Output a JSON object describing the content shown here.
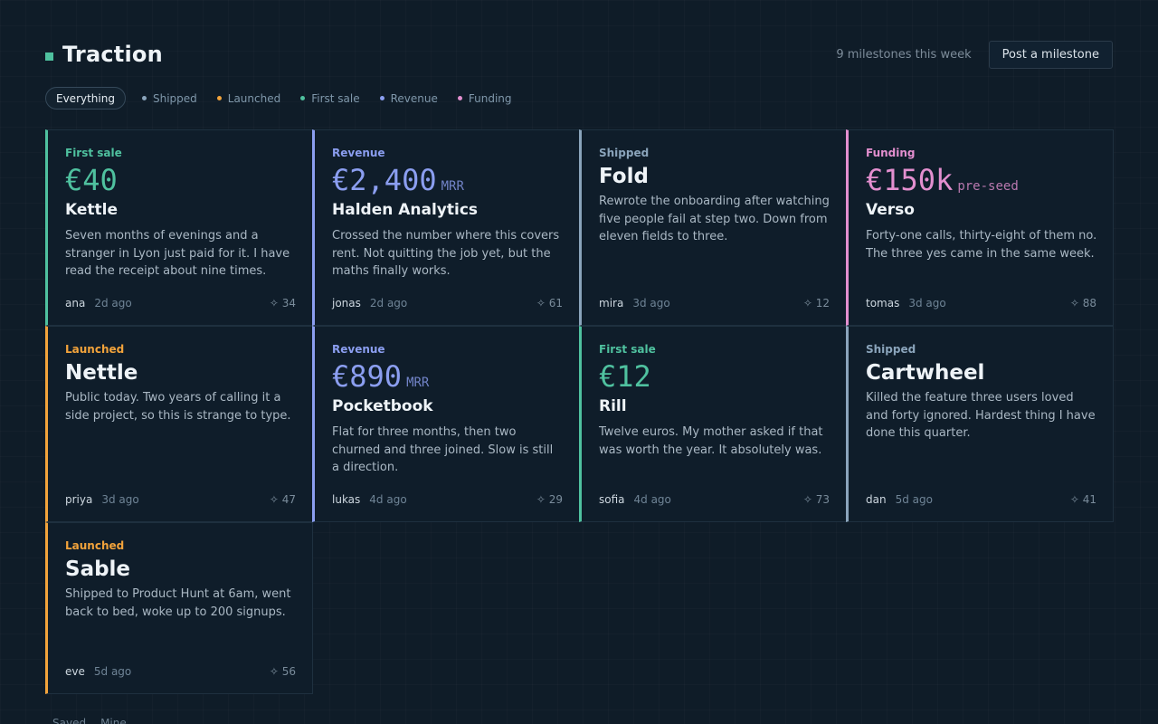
{
  "header": {
    "title": "Traction",
    "week_count": "9 milestones this week",
    "post_label": "Post a milestone"
  },
  "filters": {
    "all": "Everything",
    "items": [
      {
        "label": "Shipped",
        "color": "#8aa4bb"
      },
      {
        "label": "Launched",
        "color": "#f2a33b"
      },
      {
        "label": "First sale",
        "color": "#4fc19f"
      },
      {
        "label": "Revenue",
        "color": "#8b9ef0"
      },
      {
        "label": "Funding",
        "color": "#e38fcf"
      }
    ]
  },
  "colors": {
    "first_sale": "#4fc19f",
    "revenue": "#8b9ef0",
    "shipped": "#8aa4bb",
    "funding": "#e38fcf",
    "launched": "#f2a33b"
  },
  "cards": [
    {
      "category": "First sale",
      "amount": "€40",
      "suffix": "",
      "name": "Kettle",
      "desc": "Seven months of evenings and a stranger in Lyon just paid for it. I have read the receipt about nine times.",
      "author": "ana",
      "ago": "2d ago",
      "score": "✧ 34"
    },
    {
      "category": "Revenue",
      "amount": "€2,400",
      "suffix": "MRR",
      "name": "Halden Analytics",
      "desc": "Crossed the number where this covers rent. Not quitting the job yet, but the maths finally works.",
      "author": "jonas",
      "ago": "2d ago",
      "score": "✧ 61"
    },
    {
      "category": "Shipped",
      "amount": "",
      "suffix": "",
      "name": "Fold",
      "desc": "Rewrote the onboarding after watching five people fail at step two. Down from eleven fields to three.",
      "author": "mira",
      "ago": "3d ago",
      "score": "✧ 12"
    },
    {
      "category": "Funding",
      "amount": "€150k",
      "suffix": "pre-seed",
      "name": "Verso",
      "desc": "Forty-one calls, thirty-eight of them no. The three yes came in the same week.",
      "author": "tomas",
      "ago": "3d ago",
      "score": "✧ 88"
    },
    {
      "category": "Launched",
      "amount": "",
      "suffix": "",
      "name": "Nettle",
      "desc": "Public today. Two years of calling it a side project, so this is strange to type.",
      "author": "priya",
      "ago": "3d ago",
      "score": "✧ 47"
    },
    {
      "category": "Revenue",
      "amount": "€890",
      "suffix": "MRR",
      "name": "Pocketbook",
      "desc": "Flat for three months, then two churned and three joined. Slow is still a direction.",
      "author": "lukas",
      "ago": "4d ago",
      "score": "✧ 29"
    },
    {
      "category": "First sale",
      "amount": "€12",
      "suffix": "",
      "name": "Rill",
      "desc": "Twelve euros. My mother asked if that was worth the year. It absolutely was.",
      "author": "sofia",
      "ago": "4d ago",
      "score": "✧ 73"
    },
    {
      "category": "Shipped",
      "amount": "",
      "suffix": "",
      "name": "Cartwheel",
      "desc": "Killed the feature three users loved and forty ignored. Hardest thing I have done this quarter.",
      "author": "dan",
      "ago": "5d ago",
      "score": "✧ 41"
    },
    {
      "category": "Launched",
      "amount": "",
      "suffix": "",
      "name": "Sable",
      "desc": "Shipped to Product Hunt at 6am, went back to bed, woke up to 200 signups.",
      "author": "eve",
      "ago": "5d ago",
      "score": "✧ 56"
    }
  ],
  "bottom_tabs": [
    "Saved",
    "Mine"
  ]
}
